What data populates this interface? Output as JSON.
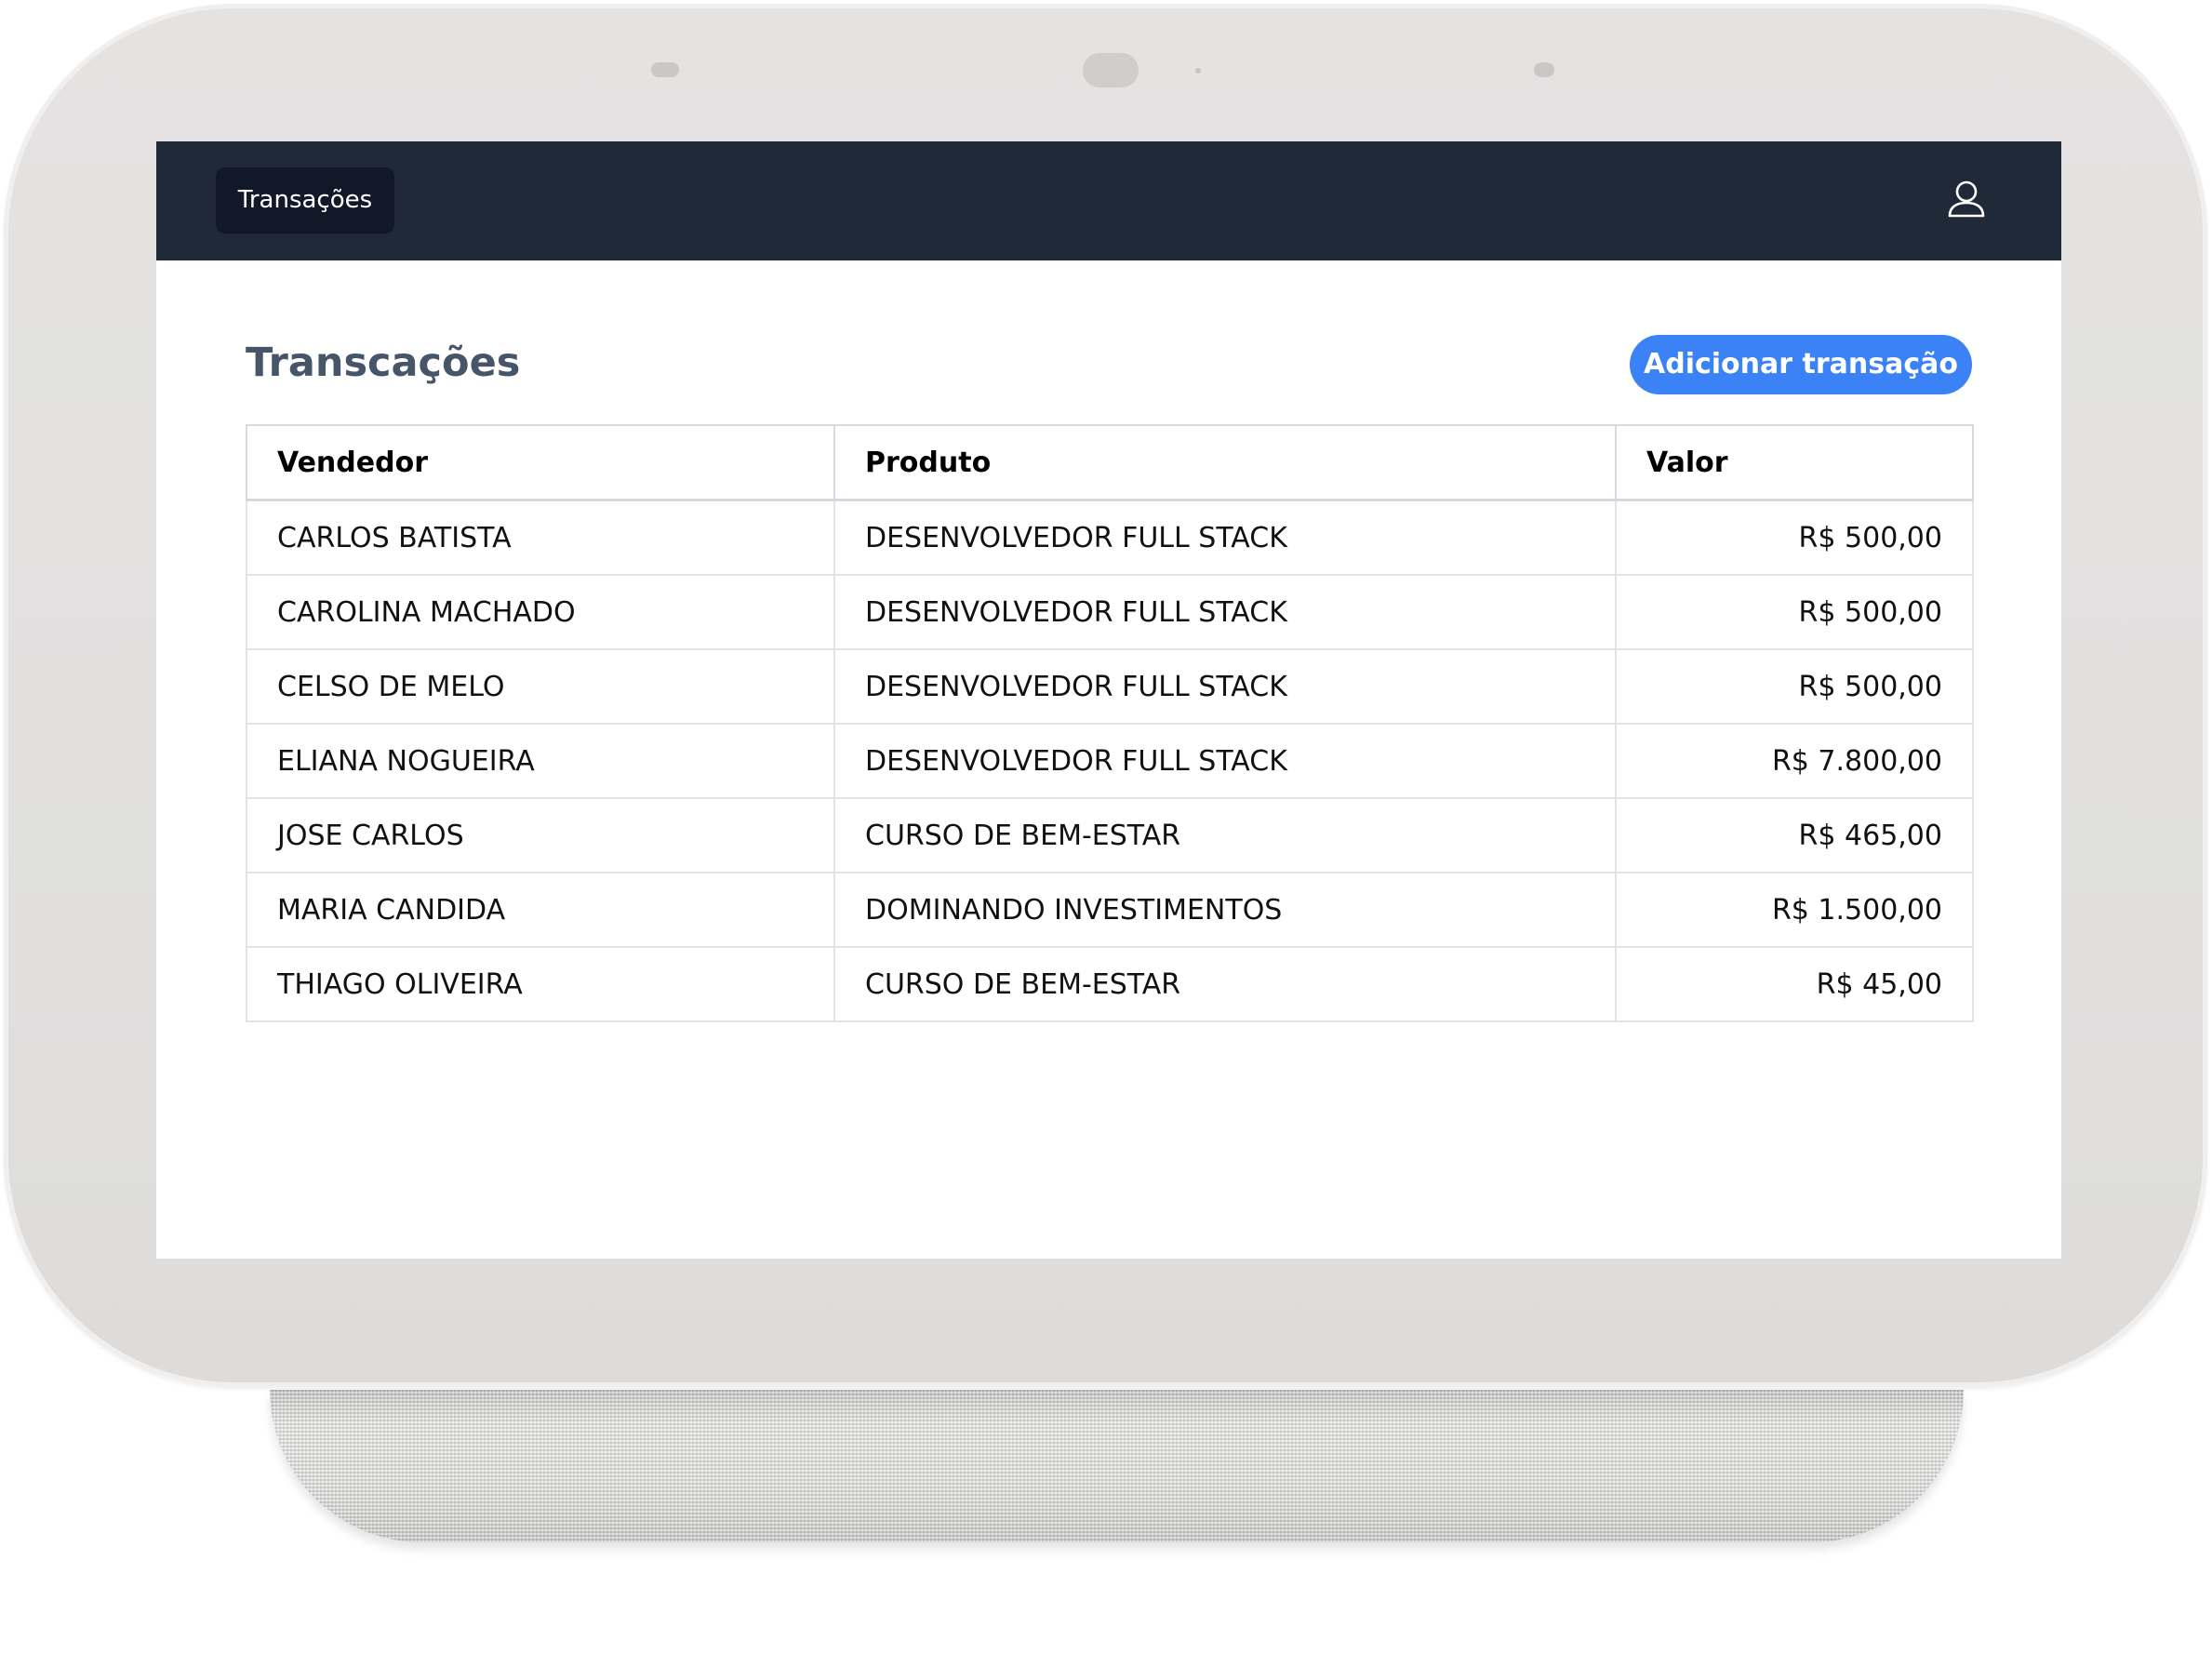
{
  "colors": {
    "navbar_bg": "#1f2937",
    "nav_tab_bg": "#111827",
    "accent": "#3b82f6",
    "title_color": "#475569",
    "device_frame": "#e1e0df",
    "device_base": "#d9d8d6"
  },
  "navbar": {
    "tab_label": "Transações",
    "user_icon": "user-icon"
  },
  "main": {
    "title": "Transcações",
    "add_button_label": "Adicionar transação"
  },
  "table": {
    "headers": {
      "seller": "Vendedor",
      "product": "Produto",
      "value": "Valor"
    },
    "rows": [
      {
        "seller": "CARLOS BATISTA",
        "product": "DESENVOLVEDOR FULL STACK",
        "value": "R$ 500,00"
      },
      {
        "seller": "CAROLINA MACHADO",
        "product": "DESENVOLVEDOR FULL STACK",
        "value": "R$ 500,00"
      },
      {
        "seller": "CELSO DE MELO",
        "product": "DESENVOLVEDOR FULL STACK",
        "value": "R$ 500,00"
      },
      {
        "seller": "ELIANA NOGUEIRA",
        "product": "DESENVOLVEDOR FULL STACK",
        "value": "R$ 7.800,00"
      },
      {
        "seller": "JOSE CARLOS",
        "product": "CURSO DE BEM-ESTAR",
        "value": "R$ 465,00"
      },
      {
        "seller": "MARIA CANDIDA",
        "product": "DOMINANDO INVESTIMENTOS",
        "value": "R$ 1.500,00"
      },
      {
        "seller": "THIAGO OLIVEIRA",
        "product": "CURSO DE BEM-ESTAR",
        "value": "R$ 45,00"
      }
    ]
  }
}
